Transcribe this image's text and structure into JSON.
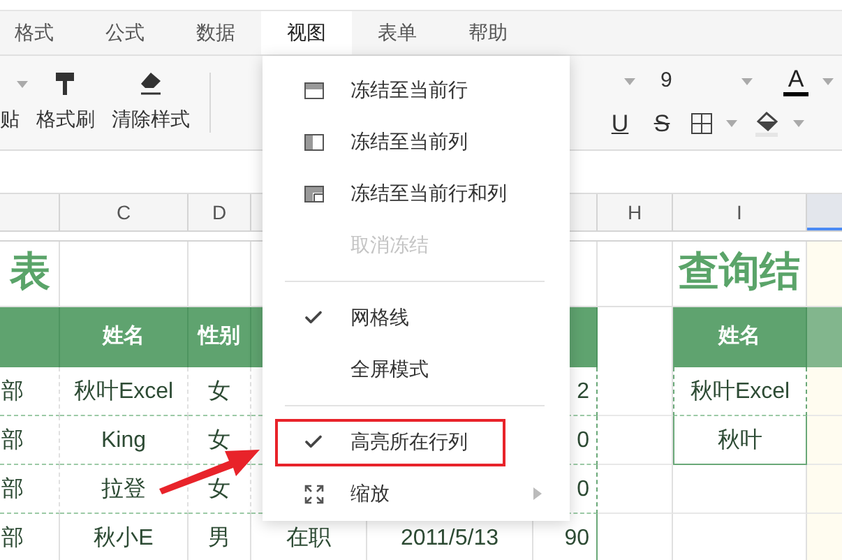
{
  "menu_tabs": [
    {
      "label": "格式",
      "selected": false
    },
    {
      "label": "公式",
      "selected": false
    },
    {
      "label": "数据",
      "selected": false
    },
    {
      "label": "视图",
      "selected": true
    },
    {
      "label": "表单",
      "selected": false
    },
    {
      "label": "帮助",
      "selected": false
    }
  ],
  "toolbar": {
    "tools": [
      {
        "label": "贴",
        "kind": "paste"
      },
      {
        "label": "格式刷",
        "kind": "brush"
      },
      {
        "label": "清除样式",
        "kind": "eraser"
      }
    ],
    "font_size": "9",
    "format_buttons": [
      {
        "kind": "underline",
        "glyph": "U"
      },
      {
        "kind": "strike",
        "glyph": "S"
      },
      {
        "kind": "borders"
      },
      {
        "kind": "fill"
      }
    ],
    "text_color": {
      "glyph": "A",
      "color": "#000000"
    }
  },
  "columns": {
    "C": {
      "label": "C",
      "selected": false
    },
    "D": {
      "label": "D",
      "selected": false
    },
    "H": {
      "label": "H",
      "selected": false
    },
    "I": {
      "label": "I",
      "selected": false
    },
    "J": {
      "selected": true
    }
  },
  "title_left": "表",
  "title_right": "查询结",
  "header_row": {
    "C": "姓名",
    "D": "性别",
    "I": "姓名"
  },
  "rows": [
    {
      "B": "部",
      "C": "秋叶Excel",
      "D": "女",
      "G": "2",
      "I": "秋叶Excel"
    },
    {
      "B": "部",
      "C": "King",
      "D": "女",
      "G": "0",
      "I": "秋叶"
    },
    {
      "B": "部",
      "C": "拉登",
      "D": "女",
      "G": "0"
    },
    {
      "B": "部",
      "C": "秋小E",
      "D": "男",
      "E": "在职",
      "F": "2011/5/13",
      "G": "90"
    }
  ],
  "view_menu": [
    {
      "kind": "freeze_row",
      "label": "冻结至当前行",
      "disabled": false
    },
    {
      "kind": "freeze_column",
      "label": "冻结至当前列",
      "disabled": false
    },
    {
      "kind": "freeze_both",
      "label": "冻结至当前行和列",
      "disabled": false
    },
    {
      "kind": "plain",
      "label": "取消冻结",
      "disabled": true
    },
    {
      "kind": "divider"
    },
    {
      "kind": "toggle",
      "label": "网格线",
      "checked": true,
      "outlined": false
    },
    {
      "kind": "toggle",
      "label": "全屏模式",
      "checked": false,
      "outlined": false
    },
    {
      "kind": "divider"
    },
    {
      "kind": "toggle",
      "label": "高亮所在行列",
      "checked": true,
      "outlined": true
    },
    {
      "kind": "submenu",
      "label": "缩放"
    }
  ]
}
